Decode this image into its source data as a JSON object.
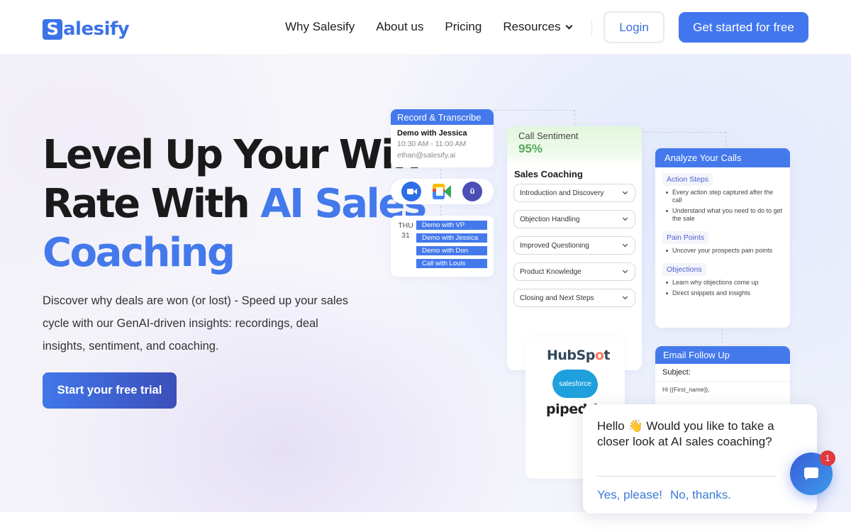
{
  "brand": {
    "name_initial": "S",
    "name_rest": "alesify",
    "accent_color": "#4479ec"
  },
  "nav": {
    "links": [
      "Why Salesify",
      "About us",
      "Pricing",
      "Resources"
    ],
    "login_label": "Login",
    "cta_label": "Get started for free"
  },
  "hero": {
    "headline_line1": "Level Up Your Win",
    "headline_line2_dark": "Rate With ",
    "headline_line2_blue": "AI Sales",
    "headline_line3_blue": "Coaching",
    "subtext": "Discover why deals are won (or lost) - Speed up your sales cycle with our GenAI-driven insights: recordings, deal insights, sentiment, and coaching.",
    "trial_button": "Start your free trial"
  },
  "record_card": {
    "title": "Record & Transcribe",
    "meeting": "Demo with Jessica",
    "time": "10:30 AM - 11:00 AM",
    "email": "ethan@salesify.ai",
    "icons": [
      "zoom-icon",
      "google-meet-icon",
      "teams-icon"
    ]
  },
  "calendar": {
    "day_name": "THU",
    "day_num": "31",
    "events": [
      "Demo with VP",
      "Demo with Jessica",
      "Demo with Don",
      "Call with Louis"
    ]
  },
  "coaching_card": {
    "sentiment_label": "Call Sentiment",
    "sentiment_value": "95%",
    "title": "Sales Coaching",
    "items": [
      "Introduction and Discovery",
      "Objection Handling",
      "Improved Questioning",
      "Product Knowledge",
      "Closing and Next Steps"
    ]
  },
  "analyze_card": {
    "title": "Analyze Your Calls",
    "sections": [
      {
        "tag": "Action Steps",
        "bullets": [
          "Every action step captured after the call",
          "Understand what you need to do to get the sale"
        ]
      },
      {
        "tag": "Pain Points",
        "bullets": [
          "Uncover your prospects pain points"
        ]
      },
      {
        "tag": "Objections",
        "bullets": [
          "Learn why objections come up",
          "Direct snippets and insights"
        ]
      }
    ]
  },
  "crm_card": {
    "hubspot_a": "HubSp",
    "hubspot_o": "o",
    "hubspot_b": "t",
    "salesforce": "salesforce",
    "pipedrive": "pipedrive"
  },
  "email_card": {
    "title": "Email Follow Up",
    "subject_label": "Subject:",
    "body": "Hi {{First_name}},"
  },
  "chat": {
    "message": "Hello 👋 Would you like to take a closer look at AI sales coaching?",
    "yes_label": "Yes, please!",
    "no_label": "No, thanks.",
    "badge_count": "1"
  }
}
